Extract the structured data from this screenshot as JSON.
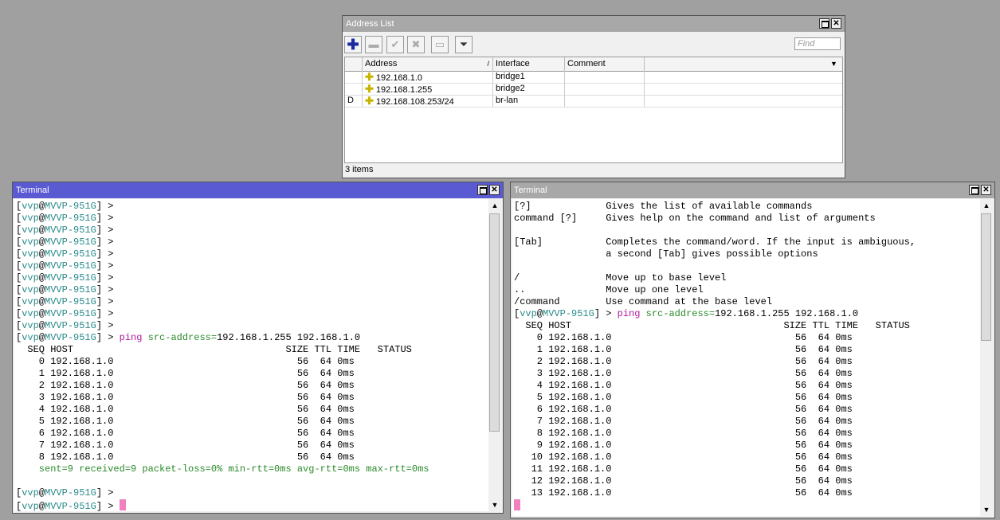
{
  "address_list": {
    "title": "Address List",
    "find_placeholder": "Find",
    "columns": [
      "Address",
      "Interface",
      "Comment"
    ],
    "rows": [
      {
        "flag": "",
        "address": "192.168.1.0",
        "interface": "bridge1",
        "comment": ""
      },
      {
        "flag": "",
        "address": "192.168.1.255",
        "interface": "bridge2",
        "comment": ""
      },
      {
        "flag": "D",
        "address": "192.168.108.253/24",
        "interface": "br-lan",
        "comment": ""
      }
    ],
    "status": "3 items",
    "toolbar": [
      "add-icon",
      "remove-icon",
      "enable-icon",
      "disable-icon",
      "comment-icon",
      "filter-icon"
    ]
  },
  "terminal_left": {
    "title": "Terminal",
    "prompt": {
      "open": "[",
      "user": "vvp",
      "at": "@",
      "host": "MVVP-951G",
      "close": "] >"
    },
    "empty_prompts": 11,
    "command": {
      "name": "ping",
      "args": "src-address=",
      "rest": "192.168.1.255 192.168.1.0"
    },
    "header": "  SEQ HOST                                     SIZE TTL TIME   STATUS",
    "rows": [
      "    0 192.168.1.0                                56  64 0ms",
      "    1 192.168.1.0                                56  64 0ms",
      "    2 192.168.1.0                                56  64 0ms",
      "    3 192.168.1.0                                56  64 0ms",
      "    4 192.168.1.0                                56  64 0ms",
      "    5 192.168.1.0                                56  64 0ms",
      "    6 192.168.1.0                                56  64 0ms",
      "    7 192.168.1.0                                56  64 0ms",
      "    8 192.168.1.0                                56  64 0ms"
    ],
    "summary": "    sent=9 received=9 packet-loss=0% min-rtt=0ms avg-rtt=0ms max-rtt=0ms"
  },
  "terminal_right": {
    "title": "Terminal",
    "help_lines": [
      "[?]             Gives the list of available commands",
      "command [?]     Gives help on the command and list of arguments",
      "",
      "[Tab]           Completes the command/word. If the input is ambiguous,",
      "                a second [Tab] gives possible options",
      "",
      "/               Move up to base level",
      "..              Move up one level",
      "/command        Use command at the base level"
    ],
    "prompt": {
      "open": "[",
      "user": "vvp",
      "at": "@",
      "host": "MVVP-951G",
      "close": "] >"
    },
    "command": {
      "name": "ping",
      "args": "src-address=",
      "rest": "192.168.1.255 192.168.1.0"
    },
    "header": "  SEQ HOST                                     SIZE TTL TIME   STATUS",
    "rows": [
      "    0 192.168.1.0                                56  64 0ms",
      "    1 192.168.1.0                                56  64 0ms",
      "    2 192.168.1.0                                56  64 0ms",
      "    3 192.168.1.0                                56  64 0ms",
      "    4 192.168.1.0                                56  64 0ms",
      "    5 192.168.1.0                                56  64 0ms",
      "    6 192.168.1.0                                56  64 0ms",
      "    7 192.168.1.0                                56  64 0ms",
      "    8 192.168.1.0                                56  64 0ms",
      "    9 192.168.1.0                                56  64 0ms",
      "   10 192.168.1.0                                56  64 0ms",
      "   11 192.168.1.0                                56  64 0ms",
      "   12 192.168.1.0                                56  64 0ms",
      "   13 192.168.1.0                                56  64 0ms"
    ]
  }
}
